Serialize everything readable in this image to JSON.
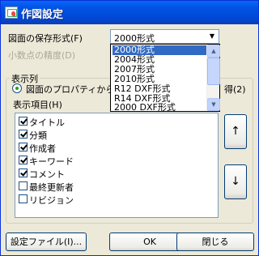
{
  "window": {
    "title": "作図設定"
  },
  "save_format": {
    "label": "図面の保存形式(F)",
    "value": "2000形式",
    "options": [
      "2000形式",
      "2004形式",
      "2007形式",
      "2010形式",
      "R12 DXF形式",
      "R14 DXF形式",
      "2000 DXF形式"
    ],
    "selected_index": 0
  },
  "precision": {
    "label": "小数点の精度(D)"
  },
  "display_columns": {
    "group_title": "表示列",
    "radio_label": "図面のプロパティから取",
    "radio_label_tail": "得(2)",
    "items_label": "表示項目(H)",
    "items": [
      {
        "label": "タイトル",
        "checked": true
      },
      {
        "label": "分類",
        "checked": true
      },
      {
        "label": "作成者",
        "checked": true
      },
      {
        "label": "キーワード",
        "checked": true
      },
      {
        "label": "コメント",
        "checked": true
      },
      {
        "label": "最終更新者",
        "checked": false
      },
      {
        "label": "リビジョン",
        "checked": false
      }
    ],
    "move_up": "↑",
    "move_down": "↓"
  },
  "buttons": {
    "settings_file": "設定ファイル(I)...",
    "ok": "OK",
    "close": "閉じる"
  }
}
